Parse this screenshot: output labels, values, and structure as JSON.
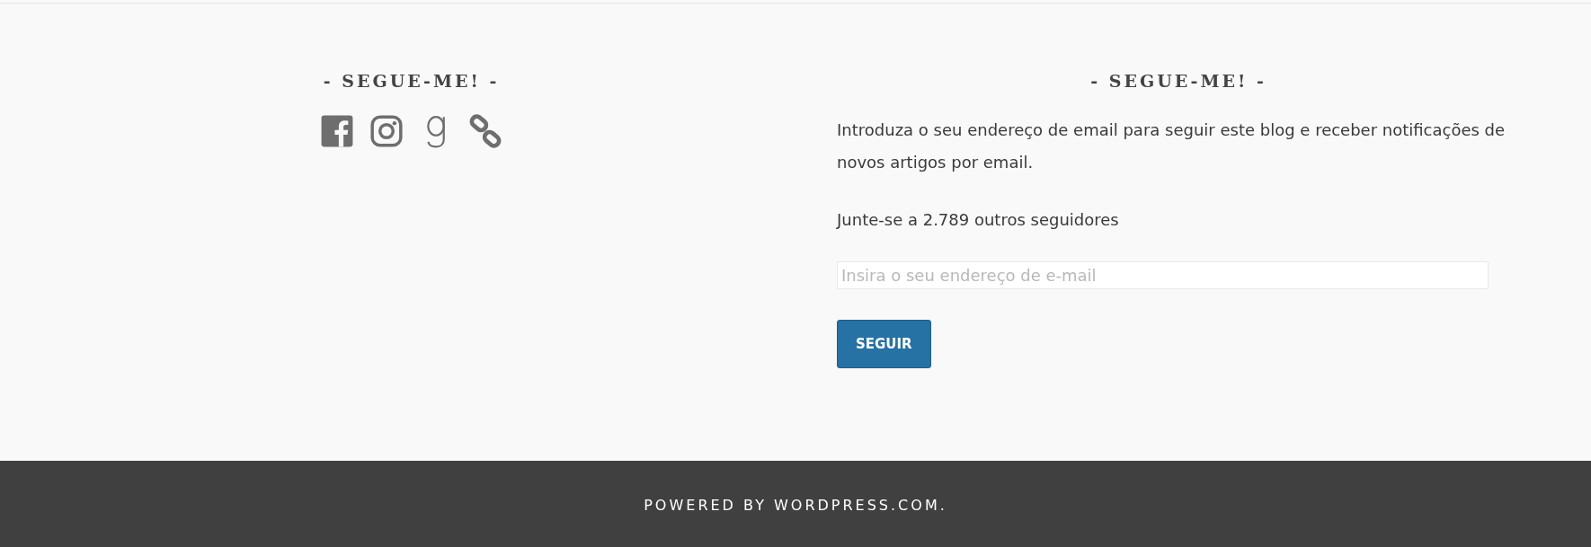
{
  "widgets": [
    {
      "kind": "social",
      "title": "- SEGUE-ME! -",
      "links": [
        {
          "kind": "facebook"
        },
        {
          "kind": "instagram"
        },
        {
          "kind": "goodreads"
        },
        {
          "kind": "link"
        }
      ]
    },
    {
      "kind": "subscribe",
      "title": "- SEGUE-ME! -",
      "description": "Introduza o seu endereço de email para seguir este blog e receber notificações de novos artigos por email.",
      "followers": "Junte-se a 2.789 outros seguidores",
      "email": {
        "placeholder": "Insira o seu endereço de e-mail"
      },
      "button": "SEGUIR"
    }
  ],
  "footer": {
    "credit": "POWERED BY WORDPRESS.COM."
  }
}
